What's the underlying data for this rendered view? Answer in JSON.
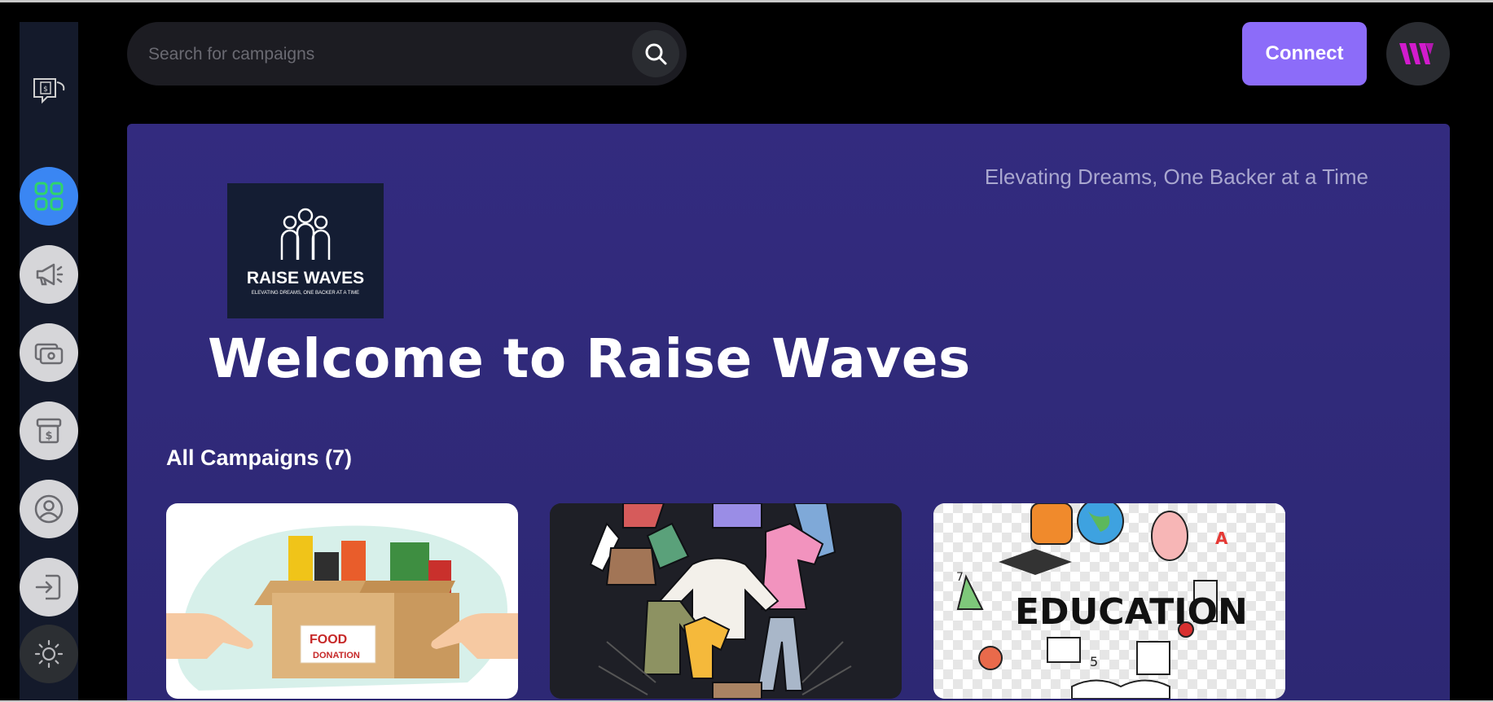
{
  "search": {
    "placeholder": "Search for campaigns",
    "icon": "search-icon"
  },
  "header": {
    "connect_label": "Connect",
    "avatar_icon": "brand-w-icon"
  },
  "sidebar": {
    "items": [
      {
        "name": "dashboard",
        "icon": "grid-icon",
        "active": true
      },
      {
        "name": "campaign",
        "icon": "megaphone-icon"
      },
      {
        "name": "payment",
        "icon": "wallet-icon"
      },
      {
        "name": "withdraw",
        "icon": "dollar-box-icon"
      },
      {
        "name": "profile",
        "icon": "user-icon"
      },
      {
        "name": "logout",
        "icon": "logout-icon"
      },
      {
        "name": "theme",
        "icon": "sun-icon"
      }
    ]
  },
  "hero": {
    "tagline": "Elevating Dreams, One Backer at a Time",
    "brand_name": "RAISE WAVES",
    "brand_tagline": "ELEVATING DREAMS, ONE BACKER AT A TIME",
    "welcome": "Welcome to Raise Waves"
  },
  "campaigns": {
    "title": "All Campaigns (7)",
    "cards": [
      {
        "image": "food-donation-image",
        "label1": "FOOD",
        "label2": "DONATION"
      },
      {
        "image": "clothes-image"
      },
      {
        "image": "education-image",
        "label": "EDUCATION"
      }
    ]
  },
  "colors": {
    "accent": "#8c6cf9",
    "active_nav": "#3a86f3",
    "hero_bg": "#332b7f"
  }
}
